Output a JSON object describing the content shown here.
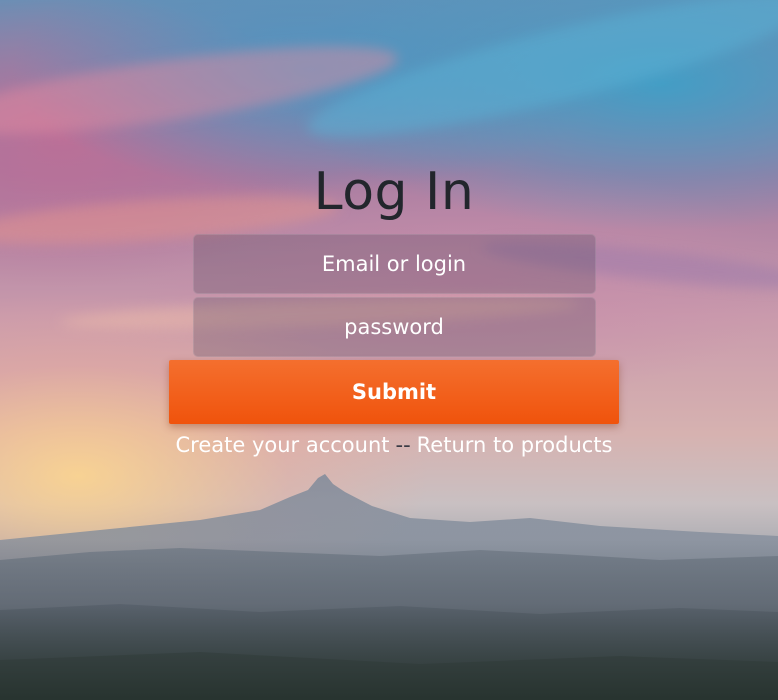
{
  "login": {
    "title": "Log In",
    "email_placeholder": "Email or login",
    "password_placeholder": "password",
    "submit_label": "Submit",
    "create_account_link": "Create your account",
    "separator": "--",
    "return_products_link": "Return to products"
  },
  "colors": {
    "submit_button": "#f0530c",
    "title_text": "#22262c"
  }
}
